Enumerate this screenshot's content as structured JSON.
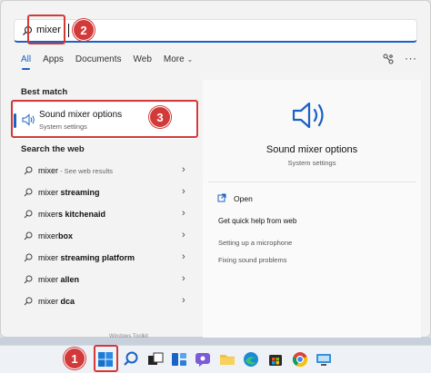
{
  "search": {
    "query": "mixer"
  },
  "tabs": [
    {
      "label": "All",
      "active": true
    },
    {
      "label": "Apps"
    },
    {
      "label": "Documents"
    },
    {
      "label": "Web"
    },
    {
      "label": "More"
    }
  ],
  "best_match": {
    "heading": "Best match",
    "title": "Sound mixer options",
    "subtitle": "System settings"
  },
  "web_section": {
    "heading": "Search the web",
    "items": [
      {
        "text": "mixer",
        "suffix": " - See web results"
      },
      {
        "text": "mixer streaming"
      },
      {
        "text": "mixers kitchenaid"
      },
      {
        "text": "mixerbox"
      },
      {
        "text": "mixer streaming platform"
      },
      {
        "text": "mixer allen"
      },
      {
        "text": "mixer dca"
      }
    ]
  },
  "preview": {
    "title": "Sound mixer options",
    "subtitle": "System settings",
    "open_label": "Open",
    "help_title": "Get quick help from web",
    "help_items": [
      "Setting up a microphone",
      "Fixing sound problems"
    ]
  },
  "annotations": [
    "1",
    "2",
    "3"
  ],
  "bottom_strip_text": "Windows Toolkit",
  "colors": {
    "accent": "#1a62c4",
    "callout": "#d23a3a"
  },
  "taskbar_icons": [
    "start-icon",
    "search-icon",
    "task-view-icon",
    "widgets-icon",
    "chat-icon",
    "file-explorer-icon",
    "edge-icon",
    "store-icon",
    "mail-icon",
    "chrome-icon",
    "remote-desktop-icon"
  ]
}
